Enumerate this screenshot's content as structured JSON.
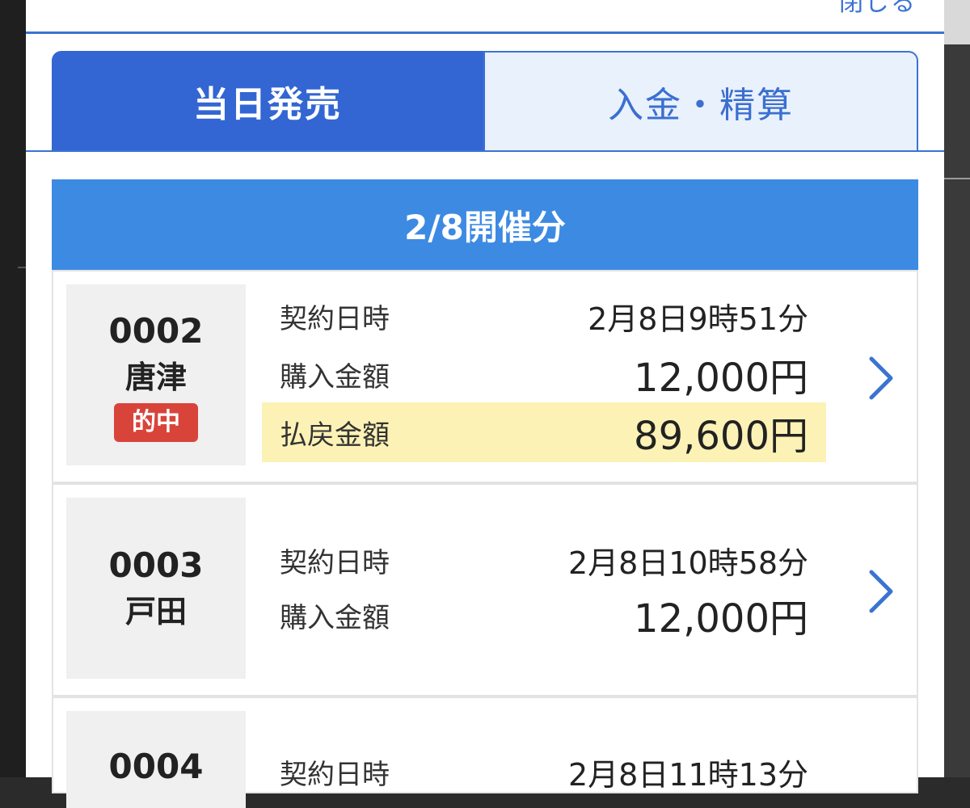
{
  "modal": {
    "close_label": "閉じる"
  },
  "tabs": [
    {
      "label": "当日発売",
      "active": true
    },
    {
      "label": "入金・精算",
      "active": false
    }
  ],
  "section": {
    "date_title": "2/8開催分"
  },
  "records": [
    {
      "number": "0002",
      "venue": "唐津",
      "badge": "的中",
      "contract_label": "契約日時",
      "contract_value": "2月8日9時51分",
      "purchase_label": "購入金額",
      "purchase_value": "12,000円",
      "payout_label": "払戻金額",
      "payout_value": "89,600円"
    },
    {
      "number": "0003",
      "venue": "戸田",
      "contract_label": "契約日時",
      "contract_value": "2月8日10時58分",
      "purchase_label": "購入金額",
      "purchase_value": "12,000円"
    },
    {
      "number": "0004",
      "contract_label": "契約日時",
      "contract_value": "2月8日11時13分"
    }
  ],
  "colors": {
    "accent": "#3366d3",
    "date_header": "#3d8ae3",
    "hit_badge": "#d9443a",
    "payout_highlight": "#fdf2b6"
  },
  "icons": {
    "row_arrow": "chevron-right-icon"
  }
}
